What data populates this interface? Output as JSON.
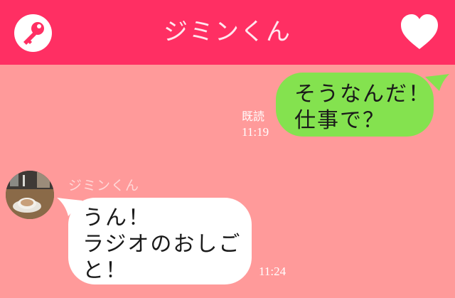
{
  "header": {
    "title": "ジミンくん",
    "left_icon": "key-icon",
    "right_icon": "heart-icon",
    "bg_color": "#ff2f63"
  },
  "chat": {
    "background_color": "#ff9a9a",
    "messages": [
      {
        "direction": "sent",
        "lines": [
          "そうなんだ！",
          "仕事で？"
        ],
        "read_label": "既読",
        "time": "11:19",
        "bubble_color": "#84e24f"
      },
      {
        "direction": "received",
        "sender": "ジミンくん",
        "avatar_icon": "coffee-avatar",
        "lines": [
          "うん！",
          "ラジオのおしご",
          "と！"
        ],
        "time": "11:24",
        "bubble_color": "#ffffff"
      }
    ]
  }
}
